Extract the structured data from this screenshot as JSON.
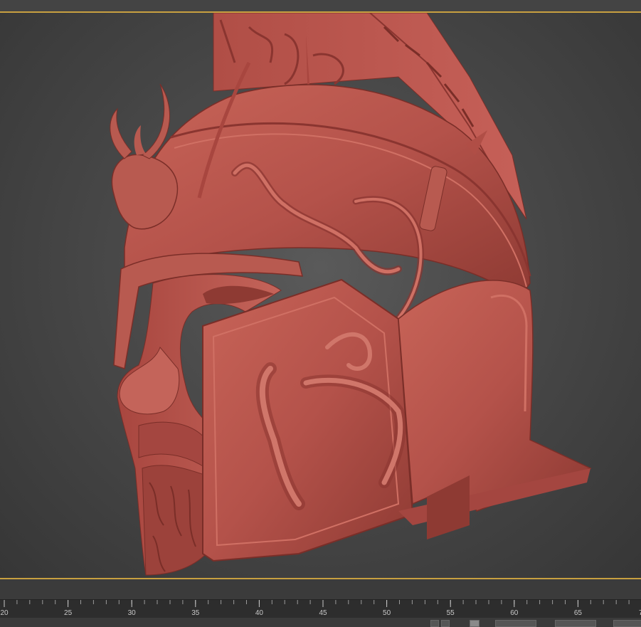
{
  "app": {
    "viewport_label": ""
  },
  "timeline": {
    "ticks": [
      "20",
      "25",
      "30",
      "35",
      "40",
      "45",
      "50",
      "55",
      "60",
      "65"
    ],
    "partial_tick": "7"
  },
  "colors": {
    "model": "#b8524a",
    "model_shadow": "#7a2e28",
    "model_highlight": "#d8786c",
    "viewport_border": "#c8a040"
  }
}
